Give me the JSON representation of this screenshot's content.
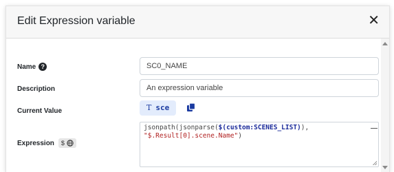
{
  "dialog": {
    "title": "Edit Expression variable",
    "close_glyph": "✕"
  },
  "fields": {
    "name": {
      "label": "Name",
      "help_glyph": "?",
      "value": "SC0_NAME"
    },
    "description": {
      "label": "Description",
      "value": "An expression variable"
    },
    "current_value": {
      "label": "Current Value",
      "type_glyph": "T",
      "value": "sce"
    },
    "expression": {
      "label": "Expression",
      "badge_dollar": "$",
      "code": {
        "line1_func1": "jsonpath(jsonparse(",
        "line1_var": "$(custom:SCENES_LIST)",
        "line1_end": "),",
        "line2_str": "\"$.Result[0].scene.Name\"",
        "line2_end": ")"
      }
    }
  },
  "icons": {
    "help": "help-icon",
    "copy": "copy-icon",
    "globe": "globe-icon",
    "close": "close-icon"
  },
  "colors": {
    "accent": "#1a3aa0",
    "pill_bg": "#e3ecfc",
    "string": "#b02020"
  }
}
